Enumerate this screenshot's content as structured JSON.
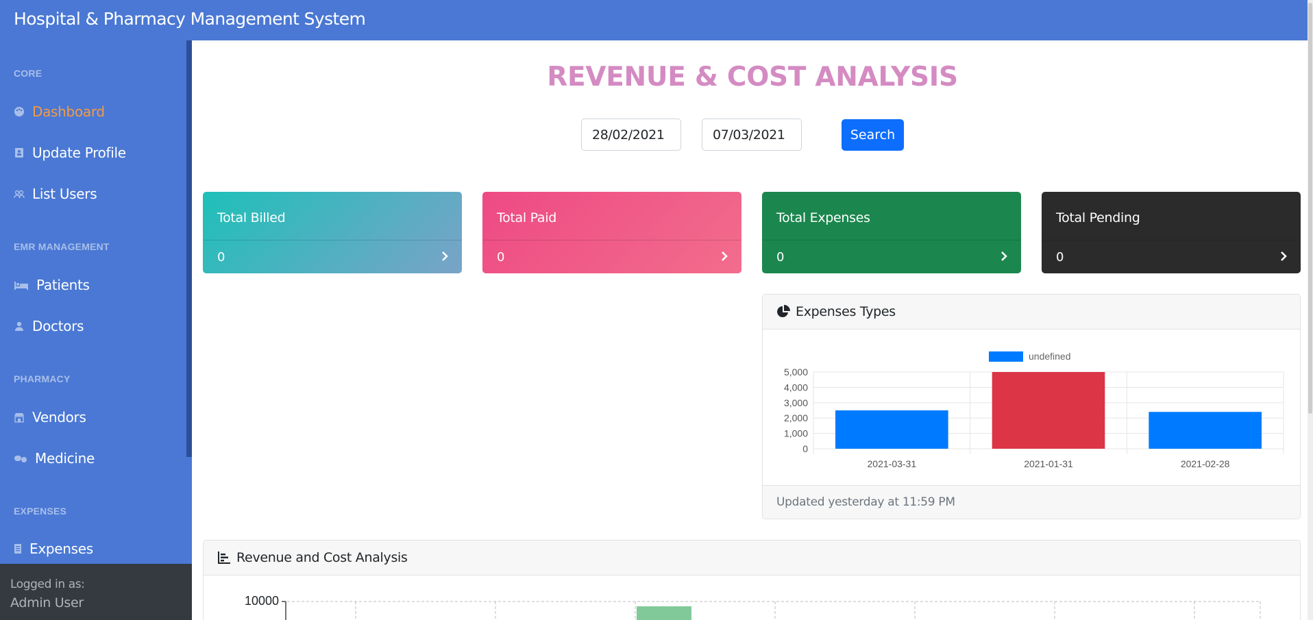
{
  "app": {
    "title": "Hospital & Pharmacy Management System"
  },
  "sidebar": {
    "sections": [
      {
        "heading": "CORE",
        "items": [
          {
            "label": "Dashboard",
            "icon": "palette-icon",
            "active": true
          },
          {
            "label": "Update Profile",
            "icon": "contact-book-icon"
          },
          {
            "label": "List Users",
            "icon": "users-icon"
          }
        ]
      },
      {
        "heading": "EMR MANAGEMENT",
        "items": [
          {
            "label": "Patients",
            "icon": "bed-icon"
          },
          {
            "label": "Doctors",
            "icon": "user-icon"
          }
        ]
      },
      {
        "heading": "PHARMACY",
        "items": [
          {
            "label": "Vendors",
            "icon": "store-icon"
          },
          {
            "label": "Medicine",
            "icon": "pills-icon"
          }
        ]
      },
      {
        "heading": "EXPENSES",
        "items": [
          {
            "label": "Expenses",
            "icon": "receipt-icon"
          }
        ]
      }
    ],
    "footer": {
      "label": "Logged in as:",
      "user": "Admin User"
    }
  },
  "main": {
    "title": "REVENUE & COST ANALYSIS",
    "filters": {
      "from_date": "28/02/2021",
      "to_date": "07/03/2021",
      "search_label": "Search"
    },
    "stats": [
      {
        "title": "Total Billed",
        "value": "0"
      },
      {
        "title": "Total Paid",
        "value": "0"
      },
      {
        "title": "Total Expenses",
        "value": "0"
      },
      {
        "title": "Total Pending",
        "value": "0"
      }
    ],
    "expenses_panel": {
      "title": "Expenses Types",
      "footer": "Updated yesterday at 11:59 PM"
    },
    "revenue_panel": {
      "title": "Revenue and Cost Analysis",
      "y_tick_top": "10000"
    }
  },
  "colors": {
    "brand": "#4a78d4",
    "accent": "#f59a42",
    "primary": "#0d6efd",
    "bar_blue": "#007bff",
    "bar_red": "#dc3545",
    "bar_green": "#82c99a"
  },
  "chart_data": [
    {
      "type": "bar",
      "title": "",
      "legend": [
        "undefined"
      ],
      "categories": [
        "2021-03-31",
        "2021-01-31",
        "2021-02-28"
      ],
      "series": [
        {
          "name": "undefined",
          "values": [
            2500,
            5000,
            2400
          ]
        }
      ],
      "bar_colors": [
        "#007bff",
        "#dc3545",
        "#007bff"
      ],
      "y_ticks": [
        "0",
        "1,000",
        "2,000",
        "3,000",
        "4,000",
        "5,000"
      ],
      "ylim": [
        0,
        5000
      ],
      "grid": true,
      "legend_position": "top"
    },
    {
      "type": "bar",
      "title": "",
      "y_ticks": [
        "10000"
      ],
      "ylim": [
        0,
        10000
      ],
      "grid": true
    }
  ]
}
